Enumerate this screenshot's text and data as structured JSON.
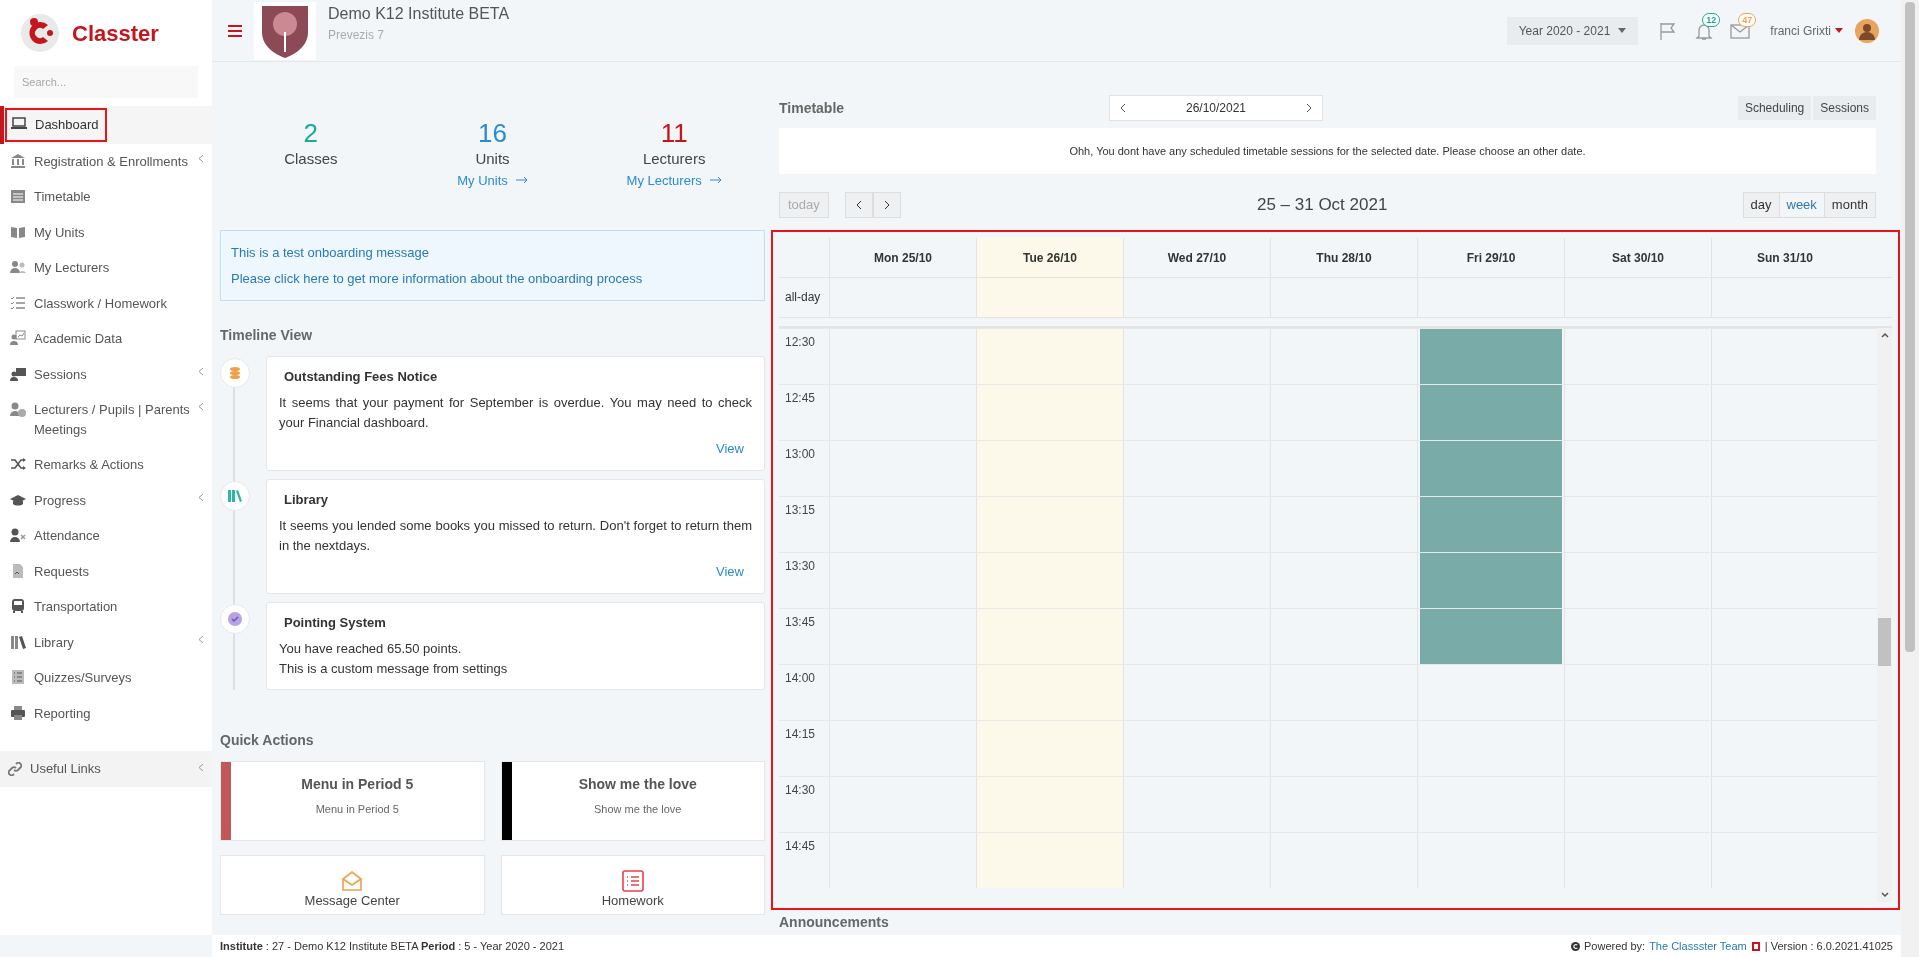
{
  "brand": {
    "name": "Classter"
  },
  "sidebar": {
    "search": {
      "placeholder": "Search..."
    },
    "items": [
      {
        "label": "Dashboard",
        "selected": true,
        "has_submenu": false
      },
      {
        "label": "Registration & Enrollments",
        "selected": false,
        "has_submenu": true
      },
      {
        "label": "Timetable",
        "selected": false,
        "has_submenu": false
      },
      {
        "label": "My Units",
        "selected": false,
        "has_submenu": false
      },
      {
        "label": "My Lecturers",
        "selected": false,
        "has_submenu": false
      },
      {
        "label": "Classwork / Homework",
        "selected": false,
        "has_submenu": false
      },
      {
        "label": "Academic Data",
        "selected": false,
        "has_submenu": false
      },
      {
        "label": "Sessions",
        "selected": false,
        "has_submenu": true
      },
      {
        "label": "Lecturers / Pupils | Parents Meetings",
        "selected": false,
        "has_submenu": true
      },
      {
        "label": "Remarks & Actions",
        "selected": false,
        "has_submenu": false
      },
      {
        "label": "Progress",
        "selected": false,
        "has_submenu": true
      },
      {
        "label": "Attendance",
        "selected": false,
        "has_submenu": false
      },
      {
        "label": "Requests",
        "selected": false,
        "has_submenu": false
      },
      {
        "label": "Transportation",
        "selected": false,
        "has_submenu": false
      },
      {
        "label": "Library",
        "selected": false,
        "has_submenu": true
      },
      {
        "label": "Quizzes/Surveys",
        "selected": false,
        "has_submenu": false
      },
      {
        "label": "Reporting",
        "selected": false,
        "has_submenu": false
      }
    ],
    "links": [
      {
        "label": "Useful Links",
        "has_submenu": true
      }
    ]
  },
  "header": {
    "institute": "Demo K12 Institute BETA",
    "address": "Prevezis 7",
    "year": "Year 2020 - 2021",
    "notifications": [
      {
        "kind": "flag"
      },
      {
        "kind": "bell",
        "count": "12",
        "color": "#1aa99a"
      },
      {
        "kind": "mail",
        "count": "47",
        "color": "#f0a04b"
      }
    ],
    "user": "franci Grixti"
  },
  "stats": [
    {
      "value": "2",
      "label": "Classes",
      "color": "#1aa99a"
    },
    {
      "value": "16",
      "label": "Units",
      "color": "#2a8bd1",
      "link": "My Units"
    },
    {
      "value": "11",
      "label": "Lecturers",
      "color": "#c4161c",
      "link": "My Lecturers"
    }
  ],
  "onboarding": {
    "message": "This is a test onboarding message",
    "link": "Please click here to get more information about the onboarding process"
  },
  "timeline": {
    "title": "Timeline View",
    "items": [
      {
        "kind": "fees",
        "title": "Outstanding Fees Notice",
        "text": "It seems that your payment for September is overdue. You may need to check your Financial dashboard.",
        "action": "View"
      },
      {
        "kind": "library",
        "title": "Library",
        "text": "It seems you lended some books you missed to return. Don't forget to return them in the nextdays.",
        "action": "View"
      },
      {
        "kind": "points",
        "title": "Pointing System",
        "lines": [
          "You have reached 65.50 points.",
          "This is a custom message from settings"
        ]
      }
    ]
  },
  "quick_actions": {
    "title": "Quick Actions",
    "items": [
      {
        "kind": "bar",
        "title": "Menu in Period 5",
        "subtitle": "Menu in Period 5",
        "color": "#c0585a"
      },
      {
        "kind": "bar",
        "title": "Show me the love",
        "subtitle": "Show me the love",
        "color": "#000000"
      },
      {
        "kind": "mail",
        "title": "Message Center"
      },
      {
        "kind": "list",
        "title": "Homework"
      }
    ]
  },
  "timetable": {
    "title": "Timetable",
    "date": "26/10/2021",
    "buttons": [
      "Scheduling",
      "Sessions"
    ],
    "message": "Ohh, You dont have any scheduled timetable sessions for the selected date. Please choose an other date."
  },
  "calendar": {
    "today_button": {
      "label": "today",
      "disabled": true
    },
    "range": "25 – 31 Oct 2021",
    "views": [
      {
        "label": "day",
        "selected": false
      },
      {
        "label": "week",
        "selected": true
      },
      {
        "label": "month",
        "selected": false
      }
    ],
    "days": [
      {
        "label": "Mon 25/10",
        "today": false
      },
      {
        "label": "Tue 26/10",
        "today": true
      },
      {
        "label": "Wed 27/10",
        "today": false
      },
      {
        "label": "Thu 28/10",
        "today": false
      },
      {
        "label": "Fri 29/10",
        "today": false
      },
      {
        "label": "Sat 30/10",
        "today": false
      },
      {
        "label": "Sun 31/10",
        "today": false
      }
    ],
    "all_day_label": "all-day",
    "slots": [
      {
        "label": "12:30",
        "busy": [
          false,
          false,
          false,
          false,
          true,
          false,
          false
        ]
      },
      {
        "label": "12:45",
        "busy": [
          false,
          false,
          false,
          false,
          true,
          false,
          false
        ]
      },
      {
        "label": "13:00",
        "busy": [
          false,
          false,
          false,
          false,
          true,
          false,
          false
        ]
      },
      {
        "label": "13:15",
        "busy": [
          false,
          false,
          false,
          false,
          true,
          false,
          false
        ]
      },
      {
        "label": "13:30",
        "busy": [
          false,
          false,
          false,
          false,
          true,
          false,
          false
        ]
      },
      {
        "label": "13:45",
        "busy": [
          false,
          false,
          false,
          false,
          true,
          false,
          false
        ]
      },
      {
        "label": "14:00",
        "busy": [
          false,
          false,
          false,
          false,
          false,
          false,
          false
        ]
      },
      {
        "label": "14:15",
        "busy": [
          false,
          false,
          false,
          false,
          false,
          false,
          false
        ]
      },
      {
        "label": "14:30",
        "busy": [
          false,
          false,
          false,
          false,
          false,
          false,
          false
        ]
      },
      {
        "label": "14:45",
        "busy": [
          false,
          false,
          false,
          false,
          false,
          false,
          false
        ]
      }
    ]
  },
  "announcements": {
    "title": "Announcements"
  },
  "footer": {
    "info": "**Institute** : 27 - Demo K12 Institute BETA **Period** : 5 - Year 2020 - 2021",
    "powered_by": "Powered by:",
    "team": "The Classster Team",
    "version": "| Version : 6.0.2021.41025"
  }
}
